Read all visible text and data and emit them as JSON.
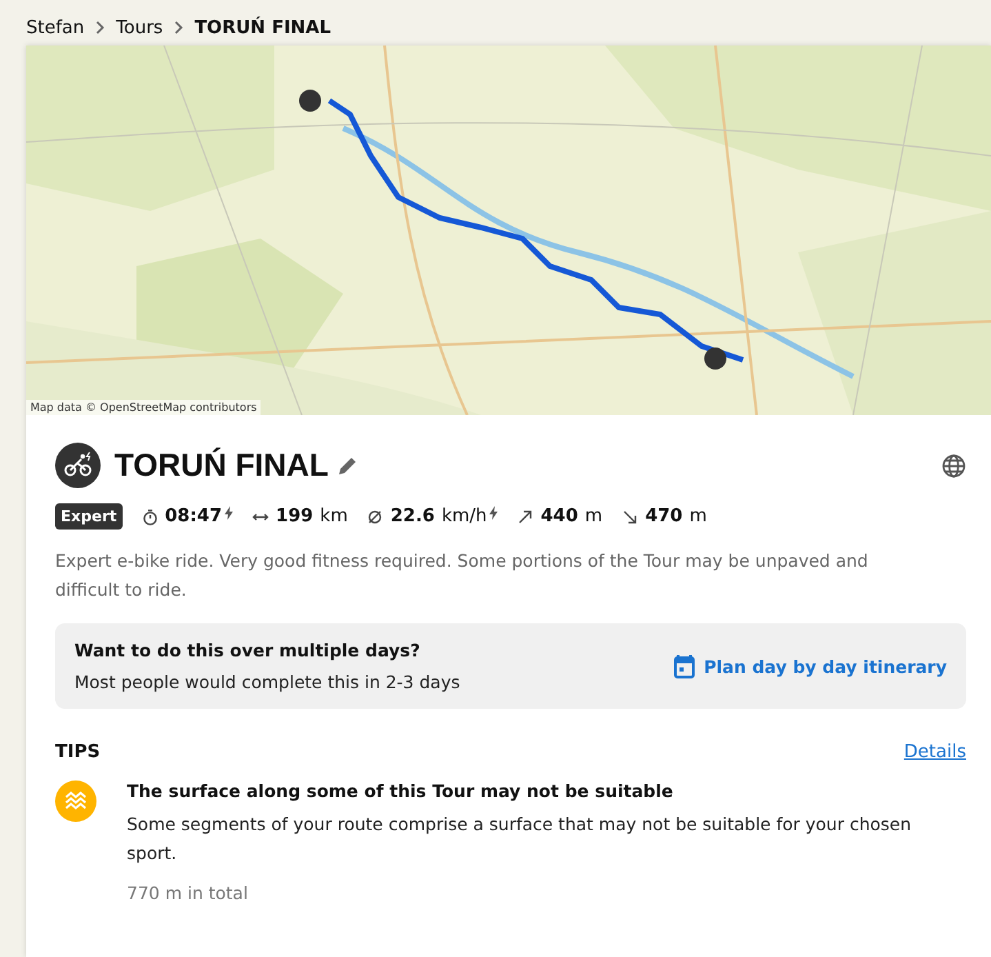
{
  "breadcrumb": [
    {
      "label": "Stefan",
      "current": false
    },
    {
      "label": "Tours",
      "current": false
    },
    {
      "label": "TORUŃ FINAL",
      "current": true
    }
  ],
  "map": {
    "kind": "picture",
    "attribution": "Map data © OpenStreetMap contributors"
  },
  "tour": {
    "title": "TORUŃ FINAL",
    "difficulty": "Expert",
    "stats": [
      {
        "kind": "duration",
        "value": "08:47",
        "ebike": true
      },
      {
        "kind": "distance",
        "value": "199",
        "unit": "km",
        "ebike": false
      },
      {
        "kind": "speed",
        "value": "22.6",
        "unit": "km/h",
        "ebike": true
      },
      {
        "kind": "uphill",
        "value": "440",
        "unit": "m",
        "ebike": false
      },
      {
        "kind": "downhill",
        "value": "470",
        "unit": "m",
        "ebike": false
      }
    ],
    "description": "Expert e-bike ride. Very good fitness required. Some portions of the Tour may be unpaved and difficult to ride."
  },
  "multiday": {
    "question": "Want to do this over multiple days?",
    "hint": "Most people would complete this in 2-3 days",
    "action": "Plan day by day itinerary"
  },
  "tips": {
    "heading": "TIPS",
    "link": "Details",
    "items": [
      {
        "title": "The surface along some of this Tour may not be suitable",
        "text": "Some segments of your route comprise a surface that may not be suitable for your chosen sport.",
        "amount": "770 m in total"
      }
    ]
  }
}
